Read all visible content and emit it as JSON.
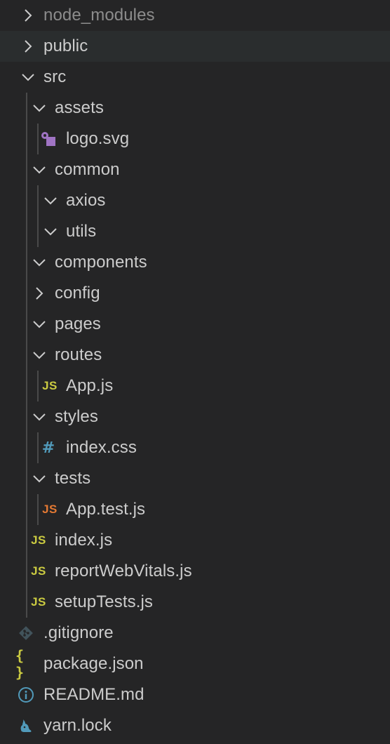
{
  "explorer": {
    "items": [
      {
        "label": "node_modules",
        "type": "folder",
        "state": "collapsed",
        "dim": true
      },
      {
        "label": "public",
        "type": "folder",
        "state": "collapsed"
      },
      {
        "label": "src",
        "type": "folder",
        "state": "expanded"
      },
      {
        "label": "assets",
        "type": "folder",
        "state": "expanded"
      },
      {
        "label": "logo.svg",
        "type": "file",
        "icon": "svg-file-icon"
      },
      {
        "label": "common",
        "type": "folder",
        "state": "expanded"
      },
      {
        "label": "axios",
        "type": "folder",
        "state": "expanded"
      },
      {
        "label": "utils",
        "type": "folder",
        "state": "expanded"
      },
      {
        "label": "components",
        "type": "folder",
        "state": "expanded"
      },
      {
        "label": "config",
        "type": "folder",
        "state": "collapsed"
      },
      {
        "label": "pages",
        "type": "folder",
        "state": "expanded"
      },
      {
        "label": "routes",
        "type": "folder",
        "state": "expanded"
      },
      {
        "label": "App.js",
        "type": "file",
        "icon": "javascript-file-icon",
        "icon_text": "JS"
      },
      {
        "label": "styles",
        "type": "folder",
        "state": "expanded"
      },
      {
        "label": "index.css",
        "type": "file",
        "icon": "css-file-icon",
        "icon_text": "#"
      },
      {
        "label": "tests",
        "type": "folder",
        "state": "expanded"
      },
      {
        "label": "App.test.js",
        "type": "file",
        "icon": "javascript-test-file-icon",
        "icon_text": "JS"
      },
      {
        "label": "index.js",
        "type": "file",
        "icon": "javascript-file-icon",
        "icon_text": "JS"
      },
      {
        "label": "reportWebVitals.js",
        "type": "file",
        "icon": "javascript-file-icon",
        "icon_text": "JS"
      },
      {
        "label": "setupTests.js",
        "type": "file",
        "icon": "javascript-file-icon",
        "icon_text": "JS"
      },
      {
        "label": ".gitignore",
        "type": "file",
        "icon": "git-file-icon"
      },
      {
        "label": "package.json",
        "type": "file",
        "icon": "json-file-icon",
        "icon_text": "{ }"
      },
      {
        "label": "README.md",
        "type": "file",
        "icon": "info-file-icon"
      },
      {
        "label": "yarn.lock",
        "type": "file",
        "icon": "yarn-file-icon"
      }
    ]
  },
  "colors": {
    "background": "#252526",
    "hover_row": "#2a2d2e",
    "text": "#cccccc",
    "dim_text": "#8c8c8c",
    "indent_guide": "#4a4a4a",
    "js_icon": "#cbcb41",
    "js_test_icon": "#e37933",
    "css_icon": "#519aba",
    "svg_icon": "#a074c4",
    "git_icon": "#41535b",
    "info_icon": "#519aba",
    "yarn_icon": "#519aba"
  }
}
